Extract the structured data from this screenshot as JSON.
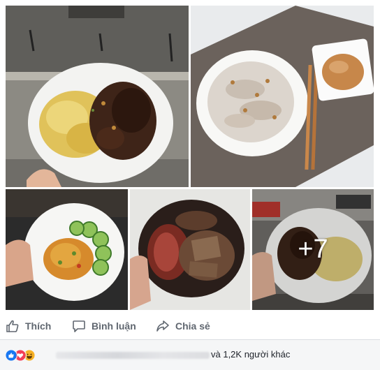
{
  "post": {
    "photos": [
      {
        "name": "photo-rice-beef"
      },
      {
        "name": "photo-banh-cuon"
      },
      {
        "name": "photo-fried-rice-cucumber"
      },
      {
        "name": "photo-steak-beef"
      },
      {
        "name": "photo-beef-rice-window",
        "more_count": "+7"
      }
    ]
  },
  "actions": {
    "like_label": "Thích",
    "comment_label": "Bình luận",
    "share_label": "Chia sẻ"
  },
  "reactions": {
    "icons": [
      "like-icon",
      "love-icon",
      "haha-icon"
    ],
    "summary_suffix": "và 1,2K người khác"
  },
  "colors": {
    "action_text": "#606770",
    "like_blue": "#1877f2",
    "love_red": "#f33e58",
    "haha_yellow": "#f7b125",
    "footer_bg": "#f5f6f7"
  }
}
